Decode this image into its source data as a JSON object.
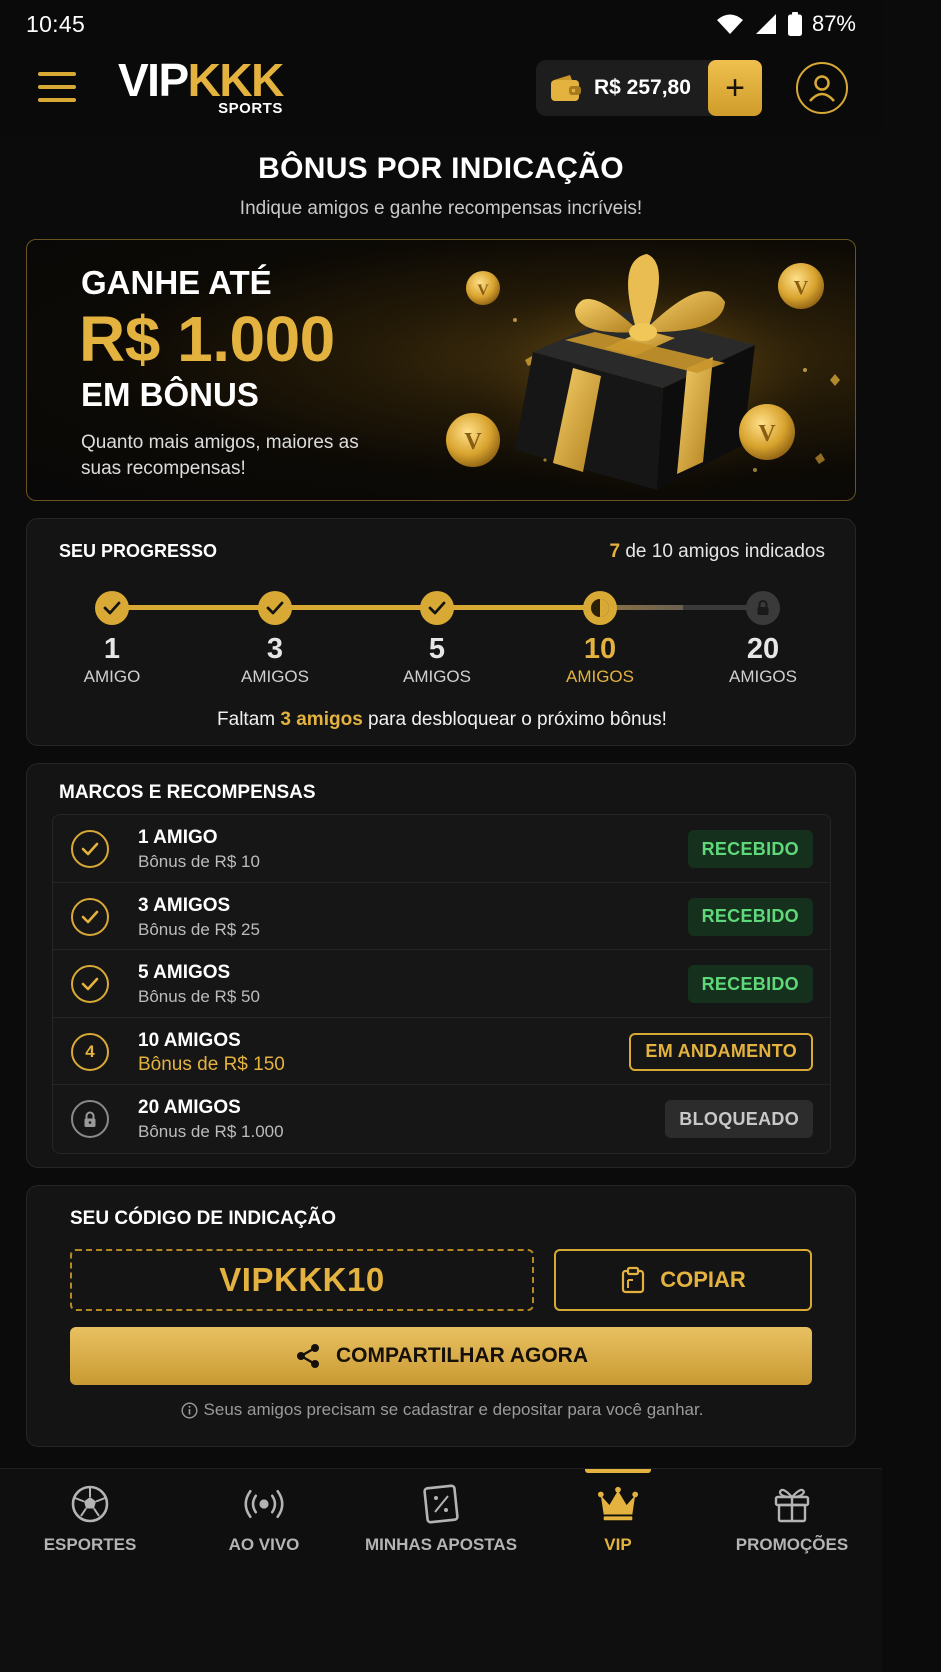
{
  "status_bar": {
    "time": "10:45",
    "battery": "87%"
  },
  "header": {
    "logo_main_1": "VIP",
    "logo_main_2": "KKK",
    "logo_sub": "SPORTS",
    "balance": "R$ 257,80",
    "add_label": "+"
  },
  "page": {
    "title": "BÔNUS POR INDICAÇÃO",
    "subtitle": "Indique amigos e ganhe recompensas incríveis!"
  },
  "hero": {
    "line1": "GANHE ATÉ",
    "amount": "R$ 1.000",
    "line3": "EM BÔNUS",
    "description": "Quanto mais amigos, maiores as suas recompensas!"
  },
  "progress": {
    "title": "SEU PROGRESSO",
    "current": "7",
    "count_suffix": "de 10 amigos indicados",
    "milestones": [
      {
        "number": "1",
        "label": "AMIGO",
        "state": "done"
      },
      {
        "number": "3",
        "label": "AMIGOS",
        "state": "done"
      },
      {
        "number": "5",
        "label": "AMIGOS",
        "state": "done"
      },
      {
        "number": "10",
        "label": "AMIGOS",
        "state": "active"
      },
      {
        "number": "20",
        "label": "AMIGOS",
        "state": "locked"
      }
    ],
    "message_pre": "Faltam ",
    "message_hl": "3 amigos",
    "message_post": " para desbloquear o próximo bônus!"
  },
  "rewards": {
    "title": "MARCOS E RECOMPENSAS",
    "items": [
      {
        "name": "1 AMIGO",
        "bonus": "Bônus de R$ 10",
        "status": "RECEBIDO",
        "state": "received",
        "icon": "check-icon"
      },
      {
        "name": "3 AMIGOS",
        "bonus": "Bônus de R$ 25",
        "status": "RECEBIDO",
        "state": "received",
        "icon": "check-icon"
      },
      {
        "name": "5 AMIGOS",
        "bonus": "Bônus de R$ 50",
        "status": "RECEBIDO",
        "state": "received",
        "icon": "check-icon"
      },
      {
        "name": "10 AMIGOS",
        "bonus": "Bônus de R$ 150",
        "status": "EM ANDAMENTO",
        "state": "progress",
        "icon_text": "4"
      },
      {
        "name": "20 AMIGOS",
        "bonus": "Bônus de R$ 1.000",
        "status": "BLOQUEADO",
        "state": "locked",
        "icon": "lock-icon"
      }
    ]
  },
  "referral": {
    "title": "SEU CÓDIGO DE INDICAÇÃO",
    "code": "VIPKKK10",
    "copy_label": "COPIAR",
    "share_label": "COMPARTILHAR AGORA",
    "note": "Seus amigos precisam se cadastrar e depositar para você ganhar."
  },
  "bottom_nav": [
    {
      "label": "ESPORTES",
      "icon": "soccer-ball-icon",
      "active": false
    },
    {
      "label": "AO VIVO",
      "icon": "live-broadcast-icon",
      "active": false
    },
    {
      "label": "MINHAS APOSTAS",
      "icon": "bet-slip-icon",
      "active": false
    },
    {
      "label": "VIP",
      "icon": "crown-icon",
      "active": true
    },
    {
      "label": "PROMOÇÕES",
      "icon": "gift-icon",
      "active": false
    }
  ],
  "colors": {
    "accent_gold": "#e4b23e",
    "background": "#0b0b0b",
    "card": "#141414",
    "success": "#5fd87a"
  }
}
